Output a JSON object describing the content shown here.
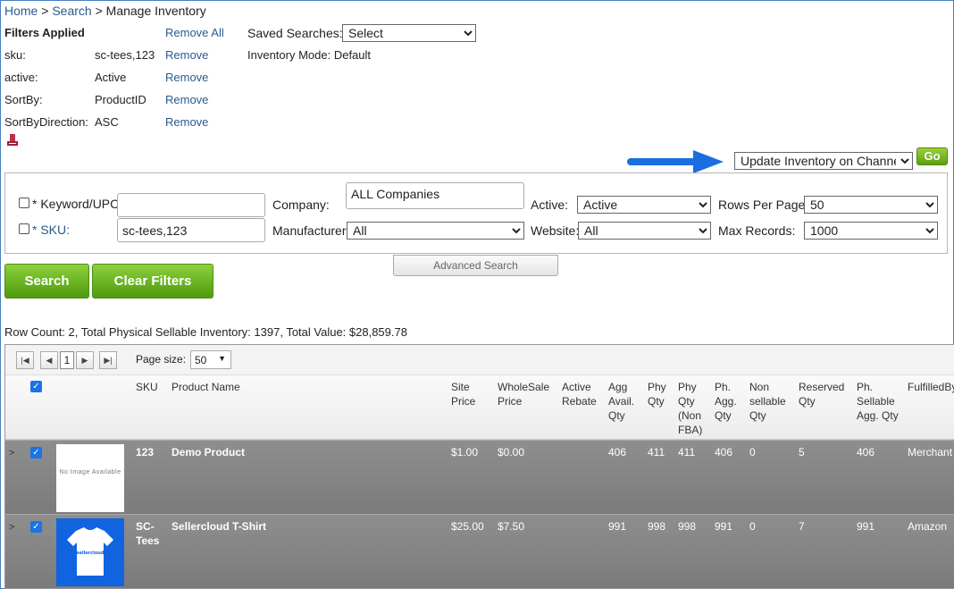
{
  "breadcrumb": {
    "home": "Home",
    "search": "Search",
    "current": "Manage Inventory",
    "sep": ">"
  },
  "filters": {
    "title": "Filters Applied",
    "remove_all": "Remove All",
    "items": [
      {
        "key": "sku:",
        "value": "sc-tees,123",
        "remove": "Remove"
      },
      {
        "key": "active:",
        "value": "Active",
        "remove": "Remove"
      },
      {
        "key": "SortBy:",
        "value": "ProductID",
        "remove": "Remove"
      },
      {
        "key": "SortByDirection:",
        "value": "ASC",
        "remove": "Remove"
      }
    ]
  },
  "saved_searches": {
    "label": "Saved Searches:",
    "value": "Select"
  },
  "inventory_mode": "Inventory Mode: Default",
  "action": {
    "select_value": "Update Inventory on Channel",
    "go_label": "Go",
    "arrow_color": "#1a6ee0"
  },
  "search_panel": {
    "keyword_label": "* Keyword/UPC:",
    "keyword_value": "",
    "sku_label": "* SKU:",
    "sku_value": "sc-tees,123",
    "company_label": "Company:",
    "company_value": "ALL Companies",
    "manufacturer_label": "Manufacturer:",
    "manufacturer_value": "All",
    "active_label": "Active:",
    "active_value": "Active",
    "website_label": "Website:",
    "website_value": "All",
    "rows_label": "Rows Per Page:",
    "rows_value": "50",
    "max_label": "Max Records:",
    "max_value": "1000",
    "advanced_label": "Advanced Search"
  },
  "buttons": {
    "search": "Search",
    "clear": "Clear Filters"
  },
  "row_count": "Row Count: 2, Total Physical Sellable Inventory: 1397, Total Value: $28,859.78",
  "pager": {
    "page": "1",
    "page_size_label": "Page size:",
    "page_size": "50"
  },
  "columns": {
    "sku": "SKU",
    "name": "Product Name",
    "site_price": "Site Price",
    "wholesale": "WholeSale Price",
    "rebate": "Active Rebate",
    "agg": "Agg Avail. Qty",
    "phy": "Phy Qty",
    "phy_nonfba": "Phy Qty (Non FBA)",
    "ph_agg": "Ph. Agg. Qty",
    "non_sellable": "Non sellable Qty",
    "reserved": "Reserved Qty",
    "ph_sellable": "Ph. Sellable Agg. Qty",
    "fulfilled": "FulfilledBy"
  },
  "rows": [
    {
      "image": "No Image Available",
      "sku": "123",
      "name": "Demo Product",
      "site_price": "$1.00",
      "wholesale": "$0.00",
      "rebate": "",
      "agg": "406",
      "phy": "411",
      "phy_nonfba": "411",
      "ph_agg": "406",
      "non_sellable": "0",
      "reserved": "5",
      "ph_sellable": "406",
      "fulfilled": "Merchant"
    },
    {
      "image": "sellercloud",
      "sku": "SC-Tees",
      "name": "Sellercloud T-Shirt",
      "site_price": "$25.00",
      "wholesale": "$7.50",
      "rebate": "",
      "agg": "991",
      "phy": "998",
      "phy_nonfba": "998",
      "ph_agg": "991",
      "non_sellable": "0",
      "reserved": "7",
      "ph_sellable": "991",
      "fulfilled": "Amazon"
    }
  ]
}
